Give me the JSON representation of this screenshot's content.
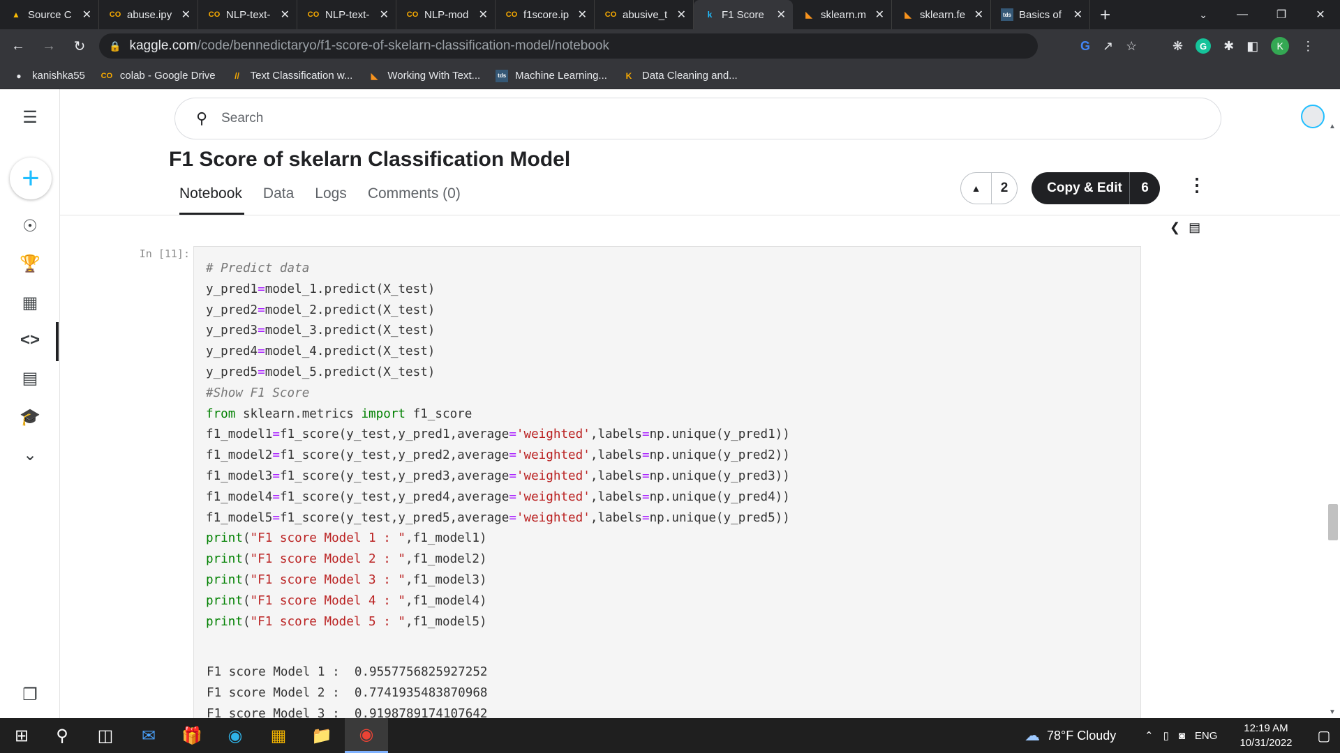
{
  "browser": {
    "tabs": [
      {
        "title": "Source C",
        "icon": "drive-icon",
        "color": "#fbbc04",
        "active": false
      },
      {
        "title": "abuse.ipy",
        "icon": "colab-icon",
        "color": "#f9ab00",
        "active": false
      },
      {
        "title": "NLP-text-",
        "icon": "colab-icon",
        "color": "#f9ab00",
        "active": false
      },
      {
        "title": "NLP-text-",
        "icon": "colab-icon",
        "color": "#f9ab00",
        "active": false
      },
      {
        "title": "NLP-mod",
        "icon": "colab-icon",
        "color": "#f9ab00",
        "active": false
      },
      {
        "title": "f1score.ip",
        "icon": "colab-icon",
        "color": "#f9ab00",
        "active": false
      },
      {
        "title": "abusive_t",
        "icon": "colab-icon",
        "color": "#f9ab00",
        "active": false
      },
      {
        "title": "F1 Score",
        "icon": "kaggle-icon",
        "color": "#20beff",
        "active": true
      },
      {
        "title": "sklearn.m",
        "icon": "sklearn-icon",
        "color": "#f7931e",
        "active": false
      },
      {
        "title": "sklearn.fe",
        "icon": "sklearn-icon",
        "color": "#f7931e",
        "active": false
      },
      {
        "title": "Basics of",
        "icon": "tds-icon",
        "color": "#355876",
        "active": false
      }
    ],
    "url_host": "kaggle.com",
    "url_path": "/code/bennedictaryo/f1-score-of-skelarn-classification-model/notebook",
    "profile_letter": "K",
    "bookmarks": [
      {
        "label": "kanishka55",
        "icon": "github-icon"
      },
      {
        "label": "colab - Google Drive",
        "icon": "colab-icon"
      },
      {
        "label": "Text Classification w...",
        "icon": "bookmark-icon"
      },
      {
        "label": "Working With Text...",
        "icon": "sklearn-icon"
      },
      {
        "label": "Machine Learning...",
        "icon": "tds-icon"
      },
      {
        "label": "Data Cleaning and...",
        "icon": "kaggle-k-icon"
      }
    ]
  },
  "kaggle": {
    "search_placeholder": "Search",
    "notebook_title": "F1 Score of skelarn Classification Model",
    "tabs": [
      "Notebook",
      "Data",
      "Logs",
      "Comments (0)"
    ],
    "vote_count": "2",
    "copy_edit_label": "Copy & Edit",
    "copy_edit_count": "6"
  },
  "cell": {
    "prompt": "In [11]:",
    "code": [
      [
        {
          "t": "# Predict data",
          "c": "cm"
        }
      ],
      [
        {
          "t": "y_pred1",
          "c": ""
        },
        {
          "t": "=",
          "c": "op"
        },
        {
          "t": "model_1.predict(X_test)",
          "c": ""
        }
      ],
      [
        {
          "t": "y_pred2",
          "c": ""
        },
        {
          "t": "=",
          "c": "op"
        },
        {
          "t": "model_2.predict(X_test)",
          "c": ""
        }
      ],
      [
        {
          "t": "y_pred3",
          "c": ""
        },
        {
          "t": "=",
          "c": "op"
        },
        {
          "t": "model_3.predict(X_test)",
          "c": ""
        }
      ],
      [
        {
          "t": "y_pred4",
          "c": ""
        },
        {
          "t": "=",
          "c": "op"
        },
        {
          "t": "model_4.predict(X_test)",
          "c": ""
        }
      ],
      [
        {
          "t": "y_pred5",
          "c": ""
        },
        {
          "t": "=",
          "c": "op"
        },
        {
          "t": "model_5.predict(X_test)",
          "c": ""
        }
      ],
      [
        {
          "t": "#Show F1 Score",
          "c": "cm"
        }
      ],
      [
        {
          "t": "from",
          "c": "kw"
        },
        {
          "t": " sklearn.metrics ",
          "c": ""
        },
        {
          "t": "import",
          "c": "kw"
        },
        {
          "t": " f1_score",
          "c": ""
        }
      ],
      [
        {
          "t": "f1_model1",
          "c": ""
        },
        {
          "t": "=",
          "c": "op"
        },
        {
          "t": "f1_score(y_test,y_pred1,average",
          "c": ""
        },
        {
          "t": "=",
          "c": "op"
        },
        {
          "t": "'weighted'",
          "c": "st"
        },
        {
          "t": ",labels",
          "c": ""
        },
        {
          "t": "=",
          "c": "op"
        },
        {
          "t": "np.unique(y_pred1))",
          "c": ""
        }
      ],
      [
        {
          "t": "f1_model2",
          "c": ""
        },
        {
          "t": "=",
          "c": "op"
        },
        {
          "t": "f1_score(y_test,y_pred2,average",
          "c": ""
        },
        {
          "t": "=",
          "c": "op"
        },
        {
          "t": "'weighted'",
          "c": "st"
        },
        {
          "t": ",labels",
          "c": ""
        },
        {
          "t": "=",
          "c": "op"
        },
        {
          "t": "np.unique(y_pred2))",
          "c": ""
        }
      ],
      [
        {
          "t": "f1_model3",
          "c": ""
        },
        {
          "t": "=",
          "c": "op"
        },
        {
          "t": "f1_score(y_test,y_pred3,average",
          "c": ""
        },
        {
          "t": "=",
          "c": "op"
        },
        {
          "t": "'weighted'",
          "c": "st"
        },
        {
          "t": ",labels",
          "c": ""
        },
        {
          "t": "=",
          "c": "op"
        },
        {
          "t": "np.unique(y_pred3))",
          "c": ""
        }
      ],
      [
        {
          "t": "f1_model4",
          "c": ""
        },
        {
          "t": "=",
          "c": "op"
        },
        {
          "t": "f1_score(y_test,y_pred4,average",
          "c": ""
        },
        {
          "t": "=",
          "c": "op"
        },
        {
          "t": "'weighted'",
          "c": "st"
        },
        {
          "t": ",labels",
          "c": ""
        },
        {
          "t": "=",
          "c": "op"
        },
        {
          "t": "np.unique(y_pred4))",
          "c": ""
        }
      ],
      [
        {
          "t": "f1_model5",
          "c": ""
        },
        {
          "t": "=",
          "c": "op"
        },
        {
          "t": "f1_score(y_test,y_pred5,average",
          "c": ""
        },
        {
          "t": "=",
          "c": "op"
        },
        {
          "t": "'weighted'",
          "c": "st"
        },
        {
          "t": ",labels",
          "c": ""
        },
        {
          "t": "=",
          "c": "op"
        },
        {
          "t": "np.unique(y_pred5))",
          "c": ""
        }
      ],
      [
        {
          "t": "print",
          "c": "kw"
        },
        {
          "t": "(",
          "c": ""
        },
        {
          "t": "\"F1 score Model 1 : \"",
          "c": "st"
        },
        {
          "t": ",f1_model1)",
          "c": ""
        }
      ],
      [
        {
          "t": "print",
          "c": "kw"
        },
        {
          "t": "(",
          "c": ""
        },
        {
          "t": "\"F1 score Model 2 : \"",
          "c": "st"
        },
        {
          "t": ",f1_model2)",
          "c": ""
        }
      ],
      [
        {
          "t": "print",
          "c": "kw"
        },
        {
          "t": "(",
          "c": ""
        },
        {
          "t": "\"F1 score Model 3 : \"",
          "c": "st"
        },
        {
          "t": ",f1_model3)",
          "c": ""
        }
      ],
      [
        {
          "t": "print",
          "c": "kw"
        },
        {
          "t": "(",
          "c": ""
        },
        {
          "t": "\"F1 score Model 4 : \"",
          "c": "st"
        },
        {
          "t": ",f1_model4)",
          "c": ""
        }
      ],
      [
        {
          "t": "print",
          "c": "kw"
        },
        {
          "t": "(",
          "c": ""
        },
        {
          "t": "\"F1 score Model 5 : \"",
          "c": "st"
        },
        {
          "t": ",f1_model5)",
          "c": ""
        }
      ]
    ],
    "output": [
      "F1 score Model 1 :  0.9557756825927252",
      "F1 score Model 2 :  0.7741935483870968",
      "F1 score Model 3 :  0.9198789174107642"
    ]
  },
  "taskbar": {
    "weather": "78°F  Cloudy",
    "language": "ENG",
    "time": "12:19 AM",
    "date": "10/31/2022"
  }
}
